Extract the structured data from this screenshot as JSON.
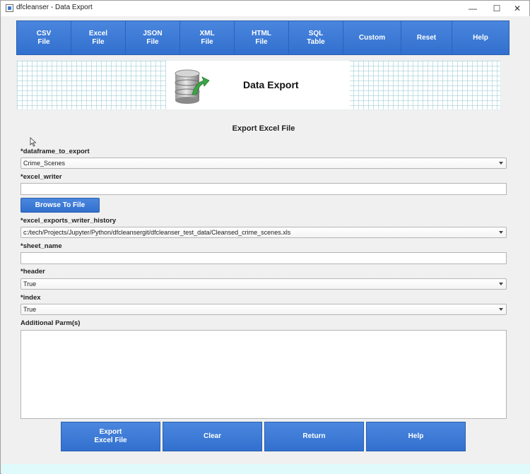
{
  "window": {
    "title": "dfcleanser - Data Export",
    "controls": {
      "minimize": "—",
      "maximize": "☐",
      "close": "✕"
    }
  },
  "toolbar": {
    "items": [
      {
        "label": "CSV\nFile"
      },
      {
        "label": "Excel\nFile"
      },
      {
        "label": "JSON\nFile"
      },
      {
        "label": "XML\nFile"
      },
      {
        "label": "HTML\nFile"
      },
      {
        "label": "SQL\nTable"
      },
      {
        "label": "Custom"
      },
      {
        "label": "Reset"
      },
      {
        "label": "Help"
      }
    ]
  },
  "banner": {
    "title": "Data Export",
    "icon": "database-export-icon"
  },
  "form": {
    "heading": "Export Excel File",
    "dataframe_to_export": {
      "label": "*dataframe_to_export",
      "value": "Crime_Scenes"
    },
    "excel_writer": {
      "label": "*excel_writer",
      "value": ""
    },
    "browse_button": "Browse To File",
    "excel_exports_writer_history": {
      "label": "*excel_exports_writer_history",
      "value": "c:/tech/Projects/Jupyter/Python/dfcleansergit/dfcleanser_test_data/Cleansed_crime_scenes.xls"
    },
    "sheet_name": {
      "label": "*sheet_name",
      "value": ""
    },
    "header": {
      "label": "*header",
      "value": "True"
    },
    "index": {
      "label": "*index",
      "value": "True"
    },
    "additional_parms": {
      "label": "Additional Parm(s)",
      "value": ""
    }
  },
  "actions": {
    "export": "Export\nExcel File",
    "clear": "Clear",
    "return": "Return",
    "help": "Help"
  },
  "colors": {
    "accent": "#3b78d6",
    "status_strip": "#dffafa"
  }
}
